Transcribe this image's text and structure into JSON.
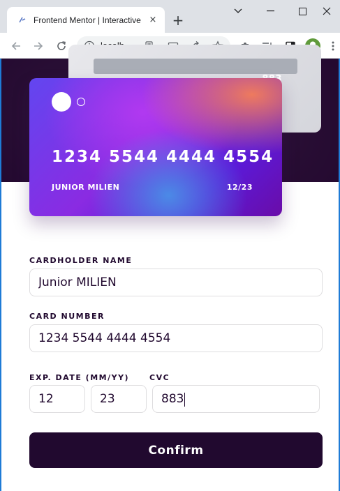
{
  "browser": {
    "tab_title": "Frontend Mentor | Interactive",
    "tab_close_glyph": "×",
    "new_tab_glyph": "+",
    "address": "localh..."
  },
  "card_back": {
    "cvc": "883"
  },
  "card_front": {
    "number": "1234 5544 4444 4554",
    "name": "JUNIOR MILIEN",
    "expiry": "12/23"
  },
  "form": {
    "cardholder_label": "CARDHOLDER NAME",
    "cardholder_value": "Junior MILIEN",
    "number_label": "CARD NUMBER",
    "number_value": "1234 5544 4444 4554",
    "exp_label": "EXP. DATE (MM/YY)",
    "exp_month_value": "12",
    "exp_year_value": "23",
    "cvc_label": "CVC",
    "cvc_value": "883",
    "confirm_label": "Confirm"
  },
  "colors": {
    "hero_bg": "#23082f",
    "button_bg": "#21092f",
    "input_border": "#dedddf"
  }
}
